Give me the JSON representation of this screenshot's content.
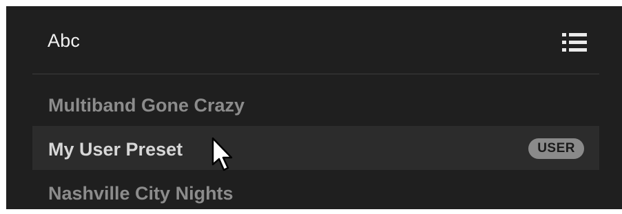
{
  "panel": {
    "title": "Abc",
    "menu_icon": "list-menu-icon"
  },
  "presets": [
    {
      "label": "Multiband Gone Crazy"
    },
    {
      "label": "My User Preset",
      "badge": "USER",
      "state": "hover"
    },
    {
      "label": "Nashville City Nights"
    }
  ],
  "cursor": {
    "icon": "mouse-pointer-icon"
  }
}
